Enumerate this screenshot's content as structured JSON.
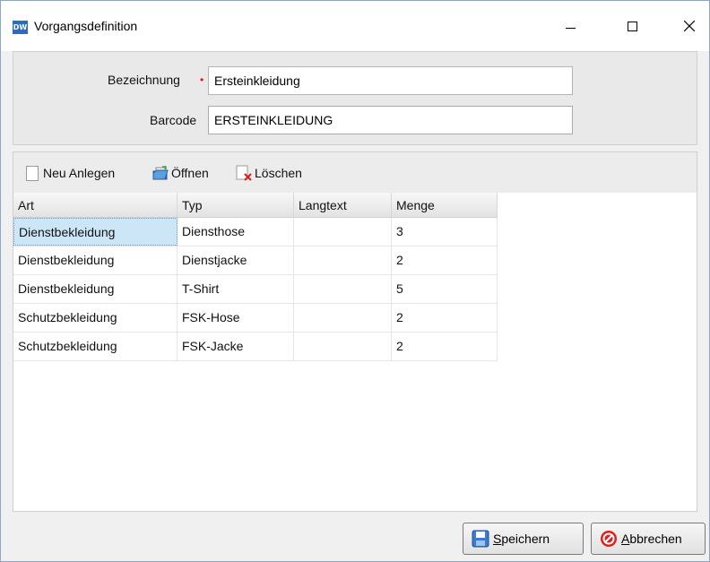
{
  "window": {
    "app_icon_text": "DW",
    "title": "Vorgangsdefinition"
  },
  "form": {
    "bezeichnung_label": "Bezeichnung",
    "required_marker": "•",
    "bezeichnung_value": "Ersteinkleidung",
    "barcode_label": "Barcode",
    "barcode_value": "ERSTEINKLEIDUNG"
  },
  "toolbar": {
    "new_label": "Neu Anlegen",
    "open_label": "Öffnen",
    "delete_label": "Löschen"
  },
  "table": {
    "columns": [
      "Art",
      "Typ",
      "Langtext",
      "Menge"
    ],
    "rows": [
      [
        "Dienstbekleidung",
        "Diensthose",
        "",
        "3"
      ],
      [
        "Dienstbekleidung",
        "Dienstjacke",
        "",
        "2"
      ],
      [
        "Dienstbekleidung",
        "T-Shirt",
        "",
        "5"
      ],
      [
        "Schutzbekleidung",
        "FSK-Hose",
        "",
        "2"
      ],
      [
        "Schutzbekleidung",
        "FSK-Jacke",
        "",
        "2"
      ]
    ]
  },
  "buttons": {
    "save_label_mnemonic": "S",
    "save_label_rest": "peichern",
    "cancel_label_mnemonic": "A",
    "cancel_label_rest": "bbrechen"
  },
  "colors": {
    "selected_cell": "#cde6f7",
    "app_icon": "#2a6cc4",
    "cancel_icon": "#e0201c"
  }
}
